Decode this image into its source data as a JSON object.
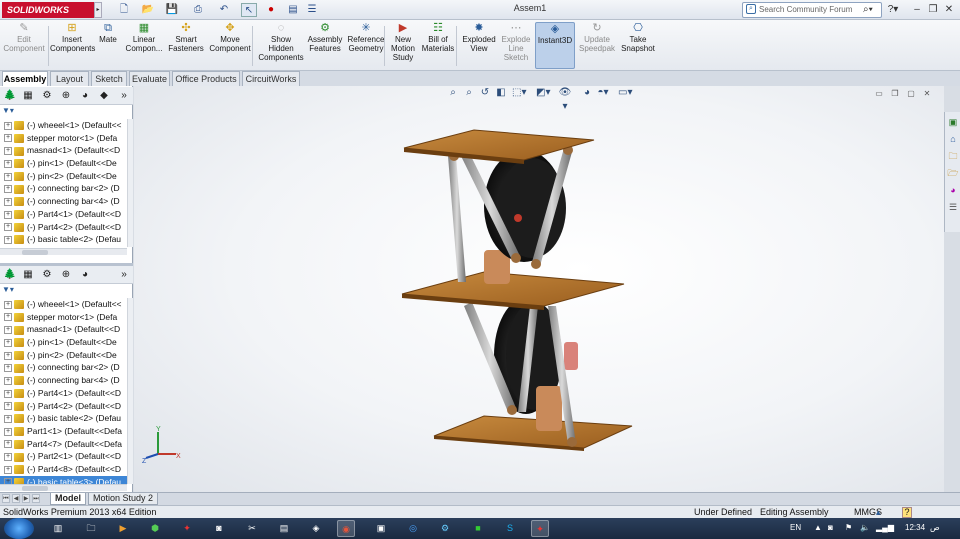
{
  "app": {
    "logo_text": "SOLIDWORKS",
    "doc_title": "Assem1",
    "brand_color": "#c8102e"
  },
  "search": {
    "placeholder": "Search Community Forum"
  },
  "toolbar": {
    "items": [
      {
        "label": "Edit\nComponent",
        "icon": "edit-component-icon",
        "disabled": true
      },
      {
        "label": "Insert\nComponents",
        "icon": "insert-components-icon"
      },
      {
        "label": "Mate",
        "icon": "mate-icon"
      },
      {
        "label": "Linear\nCompon...",
        "icon": "linear-pattern-icon"
      },
      {
        "label": "Smart\nFasteners",
        "icon": "smart-fasteners-icon"
      },
      {
        "label": "Move\nComponent",
        "icon": "move-component-icon"
      },
      {
        "label": "Show\nHidden\nComponents",
        "icon": "show-hidden-icon"
      },
      {
        "label": "Assembly\nFeatures",
        "icon": "assembly-features-icon"
      },
      {
        "label": "Reference\nGeometry",
        "icon": "reference-geometry-icon"
      },
      {
        "label": "New\nMotion\nStudy",
        "icon": "motion-study-icon"
      },
      {
        "label": "Bill of\nMaterials",
        "icon": "bom-icon"
      },
      {
        "label": "Exploded\nView",
        "icon": "exploded-view-icon"
      },
      {
        "label": "Explode\nLine\nSketch",
        "icon": "explode-line-icon",
        "disabled": true
      },
      {
        "label": "Instant3D",
        "icon": "instant3d-icon",
        "active": true
      },
      {
        "label": "Update\nSpeedpak",
        "icon": "speedpak-icon",
        "disabled": true
      },
      {
        "label": "Take\nSnapshot",
        "icon": "snapshot-icon"
      }
    ]
  },
  "tabs": [
    "Assembly",
    "Layout",
    "Sketch",
    "Evaluate",
    "Office Products",
    "CircuitWorks"
  ],
  "tree_top": [
    "(-) wheeel<1> (Default<<",
    "stepper motor<1> (Defa",
    "masnad<1> (Default<<D",
    "(-) pin<1> (Default<<De",
    "(-) pin<2> (Default<<De",
    "(-) connecting bar<2> (D",
    "(-) connecting bar<4> (D",
    "(-) Part4<1> (Default<<D",
    "(-) Part4<2> (Default<<D",
    "(-) basic table<2> (Defau",
    "Part1<1> (Default<<Defa"
  ],
  "tree_bottom": [
    "(-) wheeel<1> (Default<<",
    "stepper motor<1> (Defa",
    "masnad<1> (Default<<D",
    "(-) pin<1> (Default<<De",
    "(-) pin<2> (Default<<De",
    "(-) connecting bar<2> (D",
    "(-) connecting bar<4> (D",
    "(-) Part4<1> (Default<<D",
    "(-) Part4<2> (Default<<D",
    "(-) basic table<2> (Defau",
    "Part1<1> (Default<<Defa",
    "Part4<7> (Default<<Defa",
    "(-) Part2<1> (Default<<D",
    "(-) Part4<8> (Default<<D",
    "(-) basic table<3> (Defau"
  ],
  "bottom_tabs": [
    "Model",
    "Motion Study 2"
  ],
  "status": {
    "app_version": "SolidWorks Premium 2013 x64 Edition",
    "state": "Under Defined",
    "mode": "Editing Assembly",
    "units": "MMGS",
    "help": "?"
  },
  "taskbar": {
    "lang": "EN",
    "clock": "12:34",
    "ampm": "ص"
  },
  "axes": {
    "x": "X",
    "y": "Y",
    "z": "Z"
  }
}
